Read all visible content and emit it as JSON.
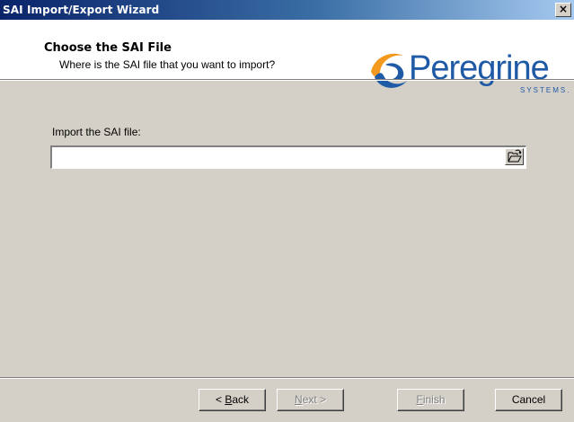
{
  "window": {
    "title": "SAI Import/Export Wizard",
    "close_label": "×"
  },
  "header": {
    "title": "Choose the SAI File",
    "subtitle": "Where is the SAI file that you want to import?",
    "logo": {
      "name": "Peregrine",
      "tagline": "SYSTEMS.",
      "colors": {
        "text": "#1f5aa6",
        "swoosh_orange": "#f39a1e",
        "swoosh_blue": "#1f5aa6"
      }
    }
  },
  "main": {
    "file_label": "Import the SAI file:",
    "file_value": "",
    "browse_icon": "open-folder-icon"
  },
  "buttons": {
    "back": {
      "accel": "B",
      "rest": "ack",
      "prefix": "< ",
      "enabled": true
    },
    "next": {
      "accel": "N",
      "rest": "ext >",
      "enabled": false
    },
    "finish": {
      "accel": "F",
      "rest": "inish",
      "enabled": false
    },
    "cancel": {
      "label": "Cancel",
      "enabled": true
    }
  }
}
